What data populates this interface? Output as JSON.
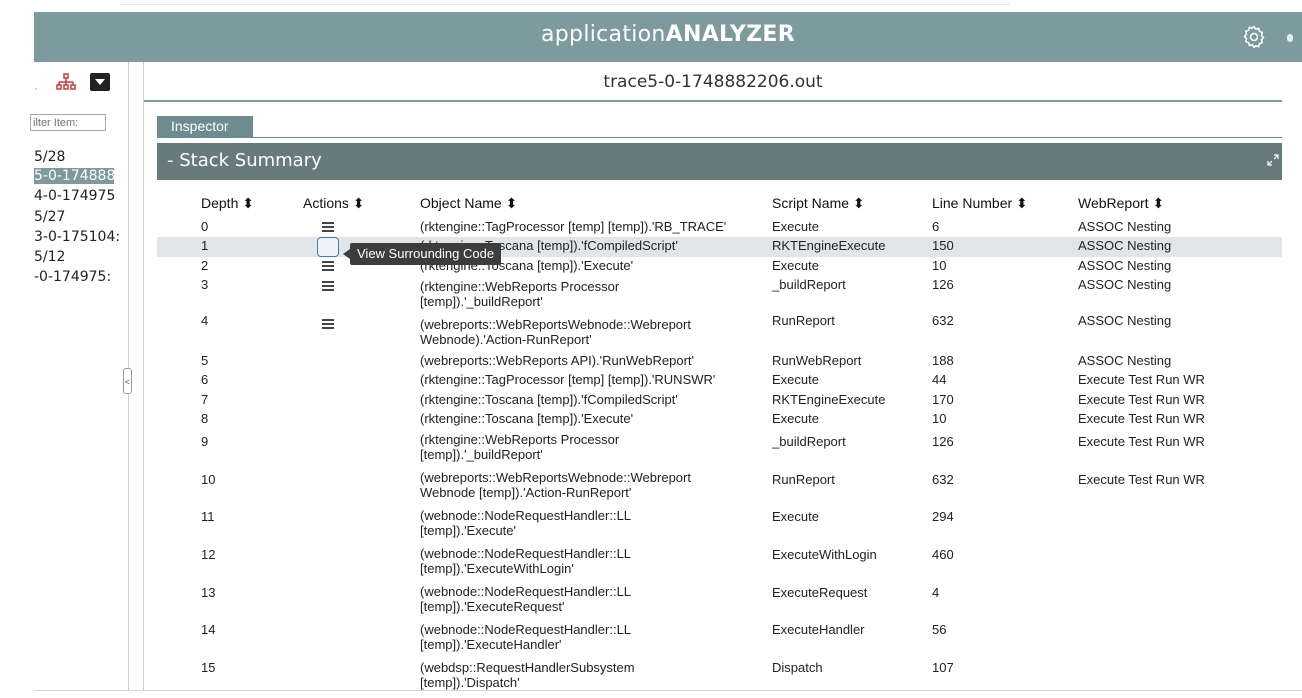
{
  "app": {
    "title_light": "application",
    "title_bold": "ANALYZER"
  },
  "left_panel": {
    "filter_placeholder": "ilter Item:",
    "items": [
      "5/28",
      "5-0-174888",
      "4-0-174975",
      "5/27",
      "3-0-175104:",
      "5/12",
      "-0-174975:"
    ]
  },
  "file": {
    "name": "trace5-0-1748882206.out"
  },
  "tabs": {
    "inspector": "Inspector"
  },
  "section": {
    "title": "- Stack Summary"
  },
  "table": {
    "headers": [
      "Depth ⬍",
      "Actions ⬍",
      "Object Name ⬍",
      "Script Name ⬍",
      "Line Number ⬍",
      "WebReport ⬍"
    ],
    "rows": [
      {
        "depth": "0",
        "object": "(rktengine::TagProcessor [temp] [temp]).'RB_TRACE'",
        "script": "Execute",
        "line": "6",
        "webreport": "ASSOC Nesting"
      },
      {
        "depth": "1",
        "object": "(rktengine::Toscana [temp]).'fCompiledScript'",
        "script": "RKTEngineExecute",
        "line": "150",
        "webreport": "ASSOC Nesting"
      },
      {
        "depth": "2",
        "object": "(rktengine::Toscana [temp]).'Execute'",
        "script": "Execute",
        "line": "10",
        "webreport": "ASSOC Nesting"
      },
      {
        "depth": "3",
        "object": "(rktengine::WebReports Processor [temp]).'_buildReport'",
        "script": "_buildReport",
        "line": "126",
        "webreport": "ASSOC Nesting"
      },
      {
        "depth": "4",
        "object": "(webreports::WebReportsWebnode::Webreport Webnode).'Action-RunReport'",
        "script": "RunReport",
        "line": "632",
        "webreport": "ASSOC Nesting"
      },
      {
        "depth": "5",
        "object": "(webreports::WebReports API).'RunWebReport'",
        "script": "RunWebReport",
        "line": "188",
        "webreport": "ASSOC Nesting"
      },
      {
        "depth": "6",
        "object": "(rktengine::TagProcessor [temp] [temp]).'RUNSWR'",
        "script": "Execute",
        "line": "44",
        "webreport": "Execute Test Run WR"
      },
      {
        "depth": "7",
        "object": "(rktengine::Toscana [temp]).'fCompiledScript'",
        "script": "RKTEngineExecute",
        "line": "170",
        "webreport": "Execute Test Run WR"
      },
      {
        "depth": "8",
        "object": "(rktengine::Toscana [temp]).'Execute'",
        "script": "Execute",
        "line": "10",
        "webreport": "Execute Test Run WR"
      },
      {
        "depth": "9",
        "object": "(rktengine::WebReports Processor [temp]).'_buildReport'",
        "script": "_buildReport",
        "line": "126",
        "webreport": "Execute Test Run WR"
      },
      {
        "depth": "10",
        "object": "(webreports::WebReportsWebnode::Webreport Webnode [temp]).'Action-RunReport'",
        "script": "RunReport",
        "line": "632",
        "webreport": "Execute Test Run WR"
      },
      {
        "depth": "11",
        "object": "(webnode::NodeRequestHandler::LL [temp]).'Execute'",
        "script": "Execute",
        "line": "294",
        "webreport": ""
      },
      {
        "depth": "12",
        "object": "(webnode::NodeRequestHandler::LL [temp]).'ExecuteWithLogin'",
        "script": "ExecuteWithLogin",
        "line": "460",
        "webreport": ""
      },
      {
        "depth": "13",
        "object": "(webnode::NodeRequestHandler::LL [temp]).'ExecuteRequest'",
        "script": "ExecuteRequest",
        "line": "4",
        "webreport": ""
      },
      {
        "depth": "14",
        "object": "(webnode::NodeRequestHandler::LL [temp]).'ExecuteHandler'",
        "script": "ExecuteHandler",
        "line": "56",
        "webreport": ""
      },
      {
        "depth": "15",
        "object": "(webdsp::RequestHandlerSubsystem [temp]).'Dispatch'",
        "script": "Dispatch",
        "line": "107",
        "webreport": ""
      }
    ]
  },
  "tooltip": {
    "text": "View Surrounding Code"
  }
}
